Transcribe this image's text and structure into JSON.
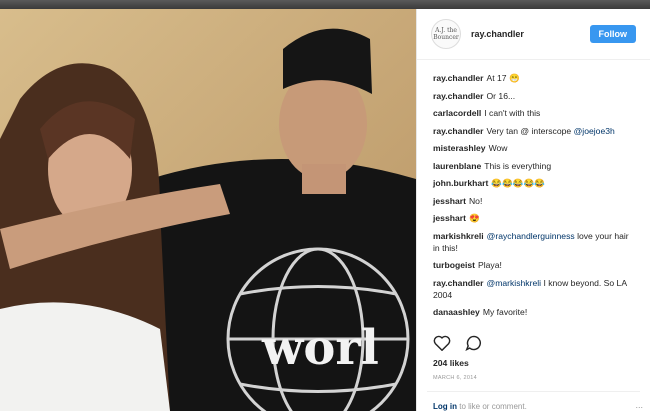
{
  "post": {
    "username": "ray.chandler",
    "avatar_text": "A.J. the Bouncer",
    "follow_label": "Follow",
    "likes": "204 likes",
    "date": "MARCH 6, 2014",
    "login_link": "Log in",
    "login_text": "to like or comment.",
    "more_symbol": "..."
  },
  "comments": [
    {
      "user": "ray.chandler",
      "text": "At 17 😁"
    },
    {
      "user": "ray.chandler",
      "text": "Or 16..."
    },
    {
      "user": "carlacordell",
      "text": "I can't with this"
    },
    {
      "user": "ray.chandler",
      "text": "Very tan @ interscope",
      "mention": "@joejoe3h"
    },
    {
      "user": "misterashley",
      "text": "Wow"
    },
    {
      "user": "laurenblane",
      "text": "This is everything"
    },
    {
      "user": "john.burkhart",
      "text": "😂😂😂😂😂"
    },
    {
      "user": "jesshart",
      "text": "No!"
    },
    {
      "user": "jesshart",
      "text": "😍"
    },
    {
      "user": "markishkreli",
      "mention": "@raychandlerguinness",
      "text": "love your hair in this!"
    },
    {
      "user": "turbogeist",
      "text": "Playa!"
    },
    {
      "user": "ray.chandler",
      "mention": "@markishkreli",
      "text": "I know beyond. So LA 2004"
    },
    {
      "user": "danaashley",
      "text": "My favorite!"
    }
  ],
  "photo": {
    "shirt_text": "worl"
  },
  "icons": {
    "heart": "heart-icon",
    "comment": "comment-icon",
    "more": "more-icon"
  },
  "colors": {
    "accent": "#3897f0",
    "text": "#262626",
    "muted": "#999999",
    "mention": "#003569"
  }
}
